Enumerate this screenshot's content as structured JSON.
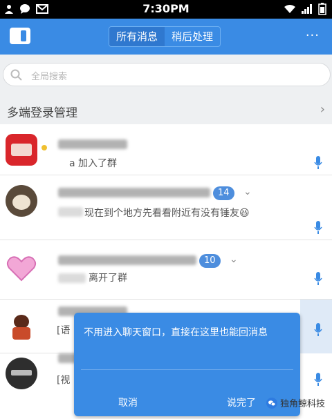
{
  "status_bar": {
    "time": "7:30PM"
  },
  "title_bar": {
    "tabs": [
      "所有消息",
      "稍后处理"
    ],
    "more_label": "···"
  },
  "search": {
    "placeholder": "全局搜索"
  },
  "section": {
    "title": "多端登录管理",
    "arrow": "›"
  },
  "conversations": [
    {
      "message": "a 加入了群"
    },
    {
      "message": "现在到个地方先看看附近有没有锤友😆",
      "badge": "14"
    },
    {
      "message": "离开了群",
      "badge": "10"
    },
    {
      "message": "[语"
    },
    {
      "message": "[视"
    }
  ],
  "popup": {
    "text": "不用进入聊天窗口，直接在这里也能回消息",
    "cancel_label": "取消",
    "done_label": "说完了"
  },
  "watermark": {
    "text": "独角鲸科技"
  },
  "colors": {
    "accent": "#3a8be4",
    "badge": "#4e8edd"
  }
}
